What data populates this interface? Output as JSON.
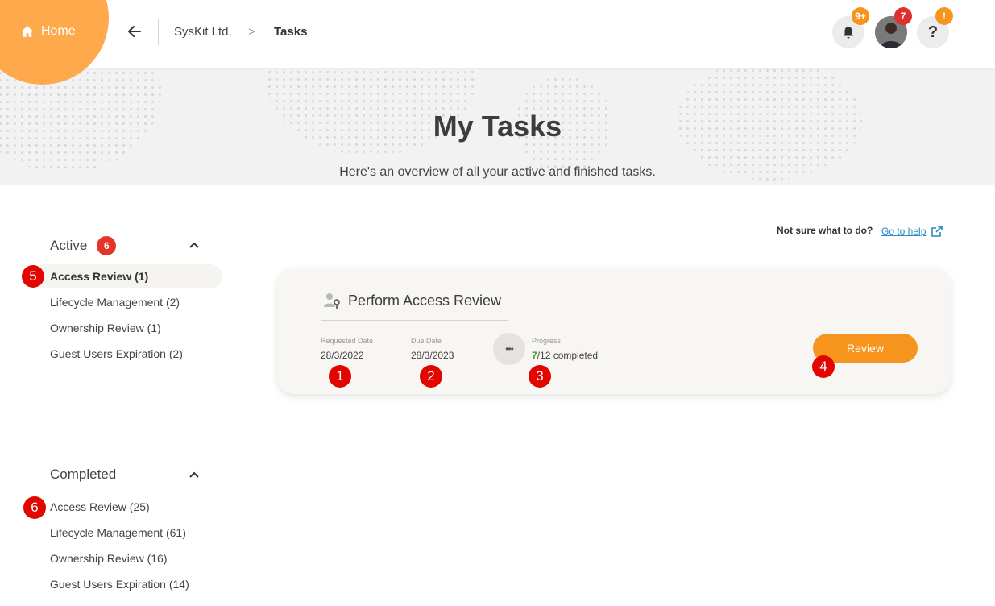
{
  "header": {
    "home_label": "Home",
    "breadcrumb": [
      "SysKit Ltd.",
      "Tasks"
    ],
    "breadcrumb_separator": ">",
    "notifications_badge": "9+",
    "avatar_badge": "7",
    "help_badge": "!",
    "help_icon_text": "?"
  },
  "hero": {
    "title": "My Tasks",
    "subtitle": "Here's an overview of all your active and finished tasks."
  },
  "sidebar": {
    "active": {
      "title": "Active",
      "count": "6",
      "items": [
        {
          "label": "Access Review (1)"
        },
        {
          "label": "Lifecycle Management (2)"
        },
        {
          "label": "Ownership Review (1)"
        },
        {
          "label": "Guest Users Expiration (2)"
        }
      ]
    },
    "completed": {
      "title": "Completed",
      "items": [
        {
          "label": "Access Review (25)"
        },
        {
          "label": "Lifecycle Management (61)"
        },
        {
          "label": "Ownership Review (16)"
        },
        {
          "label": "Guest Users Expiration (14)"
        }
      ]
    }
  },
  "help": {
    "question": "Not sure what to do?",
    "link_text": "Go to help"
  },
  "task": {
    "title": "Perform Access Review",
    "requested_label": "Requested Date",
    "requested_date": "28/3/2022",
    "due_label": "Due Date",
    "due_date": "28/3/2023",
    "progress_label": "Progress",
    "progress_done": "7",
    "progress_rest": "/12 completed",
    "progress_icon_text": "•••",
    "button_label": "Review"
  },
  "markers": [
    "1",
    "2",
    "3",
    "4",
    "5",
    "6"
  ],
  "colors": {
    "accent": "#f7941d",
    "home_blob": "#ffa94d",
    "marker_red": "#e10600",
    "count_badge": "#e2362b",
    "link": "#2a88c7",
    "progress_green": "#4c9a2a"
  }
}
